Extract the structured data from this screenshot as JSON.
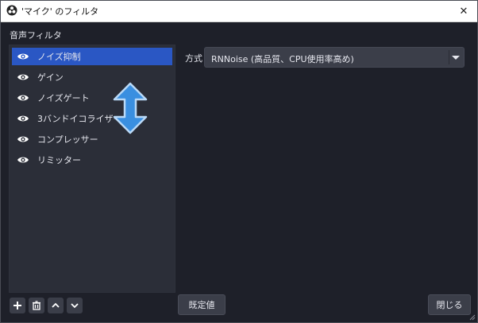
{
  "window": {
    "title": "'マイク' のフィルタ",
    "close_glyph": "✕"
  },
  "filters": {
    "section_label": "音声フィルタ",
    "items": [
      {
        "label": "ノイズ抑制",
        "visible_icon": "eye-icon",
        "selected": true
      },
      {
        "label": "ゲイン",
        "visible_icon": "eye-icon",
        "selected": false
      },
      {
        "label": "ノイズゲート",
        "visible_icon": "eye-icon",
        "selected": false
      },
      {
        "label": "3バンドイコライザー",
        "visible_icon": "eye-icon",
        "selected": false
      },
      {
        "label": "コンプレッサー",
        "visible_icon": "eye-icon",
        "selected": false
      },
      {
        "label": "リミッター",
        "visible_icon": "eye-icon",
        "selected": false
      }
    ]
  },
  "properties": {
    "method_label": "方式",
    "method_value": "RNNoise (高品質、CPU使用率高め)"
  },
  "toolbar": {
    "add_icon": "plus-icon",
    "remove_icon": "trash-icon",
    "up_icon": "chevron-up-icon",
    "down_icon": "chevron-down-icon"
  },
  "buttons": {
    "defaults_label": "既定値",
    "close_label": "閉じる"
  },
  "colors": {
    "background": "#1e2029",
    "list_background": "#2b2e38",
    "selection": "#2a57c4",
    "button": "#3b3e49",
    "overlay_arrow": "#3a8fe0"
  }
}
